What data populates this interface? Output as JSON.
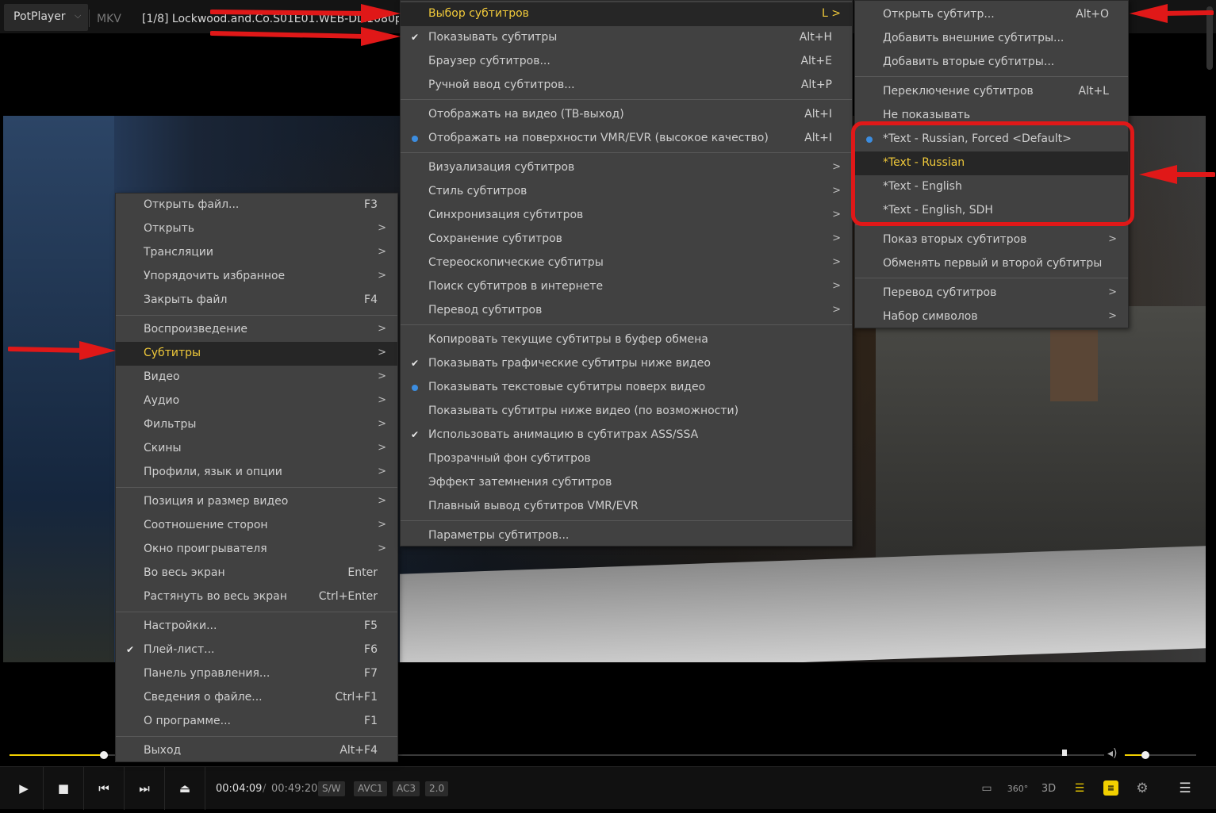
{
  "titlebar": {
    "app_name": "PotPlayer",
    "app_menu_icon": "chevron-down-icon",
    "format": "MKV",
    "file_title": "[1/8] Lockwood.and.Co.S01E01.WEB-DL.1080p"
  },
  "controls": {
    "time_current": "00:04:09",
    "time_separator": "/",
    "time_total": "00:49:20",
    "badges": [
      "S/W",
      "AVC1",
      "AC3",
      "2.0"
    ],
    "seek_progress": 0.083,
    "volume_level": 0.31,
    "icons": [
      "play-icon",
      "stop-icon",
      "previous-icon",
      "next-icon",
      "eject-icon",
      "cast-icon",
      "360-icon",
      "3d-icon",
      "playlist-search-icon",
      "subtitle-icon",
      "settings-icon",
      "menu-icon"
    ],
    "accent": "#f2d000"
  },
  "main_menu": {
    "items": [
      {
        "label": "Открыть файл...",
        "shortcut": "F3"
      },
      {
        "label": "Открыть",
        "arrow": ">"
      },
      {
        "label": "Трансляции",
        "arrow": ">"
      },
      {
        "label": "Упорядочить избранное",
        "arrow": ">"
      },
      {
        "label": "Закрыть файл",
        "shortcut": "F4"
      },
      {
        "label": "Воспроизведение",
        "arrow": ">"
      },
      {
        "label": "Субтитры",
        "arrow": ">"
      },
      {
        "label": "Видео",
        "arrow": ">"
      },
      {
        "label": "Аудио",
        "arrow": ">"
      },
      {
        "label": "Фильтры",
        "arrow": ">"
      },
      {
        "label": "Скины",
        "arrow": ">"
      },
      {
        "label": "Профили, язык и опции",
        "arrow": ">"
      },
      {
        "label": "Позиция и размер видео",
        "arrow": ">"
      },
      {
        "label": "Соотношение сторон",
        "arrow": ">"
      },
      {
        "label": "Окно проигрывателя",
        "arrow": ">"
      },
      {
        "label": "Во весь экран",
        "shortcut": "Enter"
      },
      {
        "label": "Растянуть во весь экран",
        "shortcut": "Ctrl+Enter"
      },
      {
        "label": "Настройки...",
        "shortcut": "F5"
      },
      {
        "label": "Плей-лист...",
        "shortcut": "F6",
        "check": "✔"
      },
      {
        "label": "Панель управления...",
        "shortcut": "F7"
      },
      {
        "label": "Сведения о файле...",
        "shortcut": "Ctrl+F1"
      },
      {
        "label": "О программе...",
        "shortcut": "F1"
      },
      {
        "label": "Выход",
        "shortcut": "Alt+F4"
      }
    ]
  },
  "subtitle_menu": {
    "items": [
      {
        "label": "Выбор субтитров",
        "shortcut": "L >"
      },
      {
        "label": "Показывать субтитры",
        "shortcut": "Alt+H",
        "check": "✔"
      },
      {
        "label": "Браузер субтитров...",
        "shortcut": "Alt+E"
      },
      {
        "label": "Ручной ввод субтитров...",
        "shortcut": "Alt+P"
      },
      {
        "label": "Отображать на видео (ТВ-выход)",
        "shortcut": "Alt+I"
      },
      {
        "label": "Отображать на поверхности VMR/EVR (высокое качество)",
        "shortcut": "Alt+I"
      },
      {
        "label": "Визуализация субтитров",
        "arrow": ">"
      },
      {
        "label": "Стиль субтитров",
        "arrow": ">"
      },
      {
        "label": "Синхронизация субтитров",
        "arrow": ">"
      },
      {
        "label": "Сохранение субтитров",
        "arrow": ">"
      },
      {
        "label": "Стереоскопические субтитры",
        "arrow": ">"
      },
      {
        "label": "Поиск субтитров в интернете",
        "arrow": ">"
      },
      {
        "label": "Перевод субтитров",
        "arrow": ">"
      },
      {
        "label": "Копировать текущие субтитры в буфер обмена"
      },
      {
        "label": "Показывать графические субтитры ниже видео",
        "check": "✔"
      },
      {
        "label": "Показывать текстовые субтитры поверх видео"
      },
      {
        "label": "Показывать субтитры ниже видео (по возможности)"
      },
      {
        "label": "Использовать анимацию в субтитрах ASS/SSA",
        "check": "✔"
      },
      {
        "label": "Прозрачный фон субтитров"
      },
      {
        "label": "Эффект затемнения субтитров"
      },
      {
        "label": "Плавный вывод субтитров VMR/EVR"
      },
      {
        "label": "Параметры субтитров..."
      }
    ]
  },
  "select_menu": {
    "items": [
      {
        "label": "Открыть субтитр...",
        "shortcut": "Alt+O"
      },
      {
        "label": "Добавить внешние субтитры..."
      },
      {
        "label": "Добавить вторые субтитры..."
      },
      {
        "label": "Переключение субтитров",
        "shortcut": "Alt+L"
      },
      {
        "label": "Не показывать"
      },
      {
        "label": "*Text - Russian, Forced <Default>"
      },
      {
        "label": "*Text - Russian"
      },
      {
        "label": "*Text - English"
      },
      {
        "label": "*Text - English, SDH"
      },
      {
        "label": "Показ вторых субтитров",
        "arrow": ">"
      },
      {
        "label": "Обменять первый и второй субтитры"
      },
      {
        "label": "Перевод субтитров",
        "arrow": ">"
      },
      {
        "label": "Набор символов",
        "arrow": ">"
      }
    ]
  },
  "colors": {
    "menu_bg": "#414141",
    "highlight_bg": "#262626",
    "highlight_text": "#f0c93a",
    "radio_dot": "#3c8de0",
    "annotation_red": "#e01818"
  }
}
